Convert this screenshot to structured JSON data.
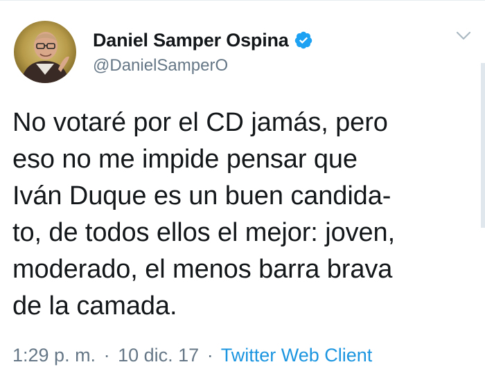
{
  "tweet": {
    "author": {
      "display_name": "Daniel Samper Ospina",
      "handle": "@DanielSamperO",
      "verified": true,
      "avatar_icon": "profile-photo-icon"
    },
    "text": "No votaré por el CD jamás, pero\neso no me impide pensar que\nIván Duque es un buen candida-\nto, de todos ellos el mejor: joven,\nmoderado, el menos barra brava\nde la camada.",
    "time": "1:29 p. m.",
    "date": "10 dic. 17",
    "separator": "·",
    "client": "Twitter Web Client"
  },
  "icons": {
    "verified": "verified-badge-icon",
    "more": "chevron-down-icon"
  },
  "colors": {
    "link": "#1b95e0",
    "verified": "#1da1f2",
    "secondary_text": "#657786",
    "primary_text": "#14171a"
  }
}
